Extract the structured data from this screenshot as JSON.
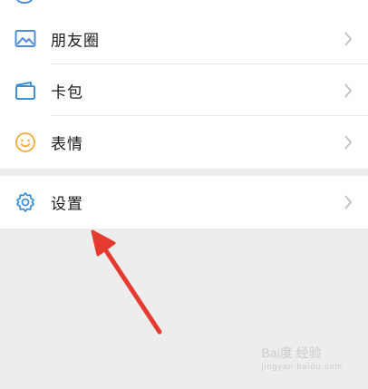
{
  "menu": {
    "items": [
      {
        "label": "朋友圈",
        "icon": "photo-icon",
        "color": "#4f8fd8"
      },
      {
        "label": "卡包",
        "icon": "card-wallet-icon",
        "color": "#3d8fd6"
      },
      {
        "label": "表情",
        "icon": "smiley-icon",
        "color": "#f3b14a"
      }
    ],
    "settings": {
      "label": "设置",
      "icon": "gear-icon",
      "color": "#3d8fd6"
    }
  },
  "colors": {
    "background": "#ededed",
    "row_background": "#ffffff",
    "arrow": "#e53a2f",
    "chevron": "#c4c4c4"
  },
  "watermark": {
    "text": "Bai度 经验",
    "sub": "jingyan.baidu.com"
  }
}
